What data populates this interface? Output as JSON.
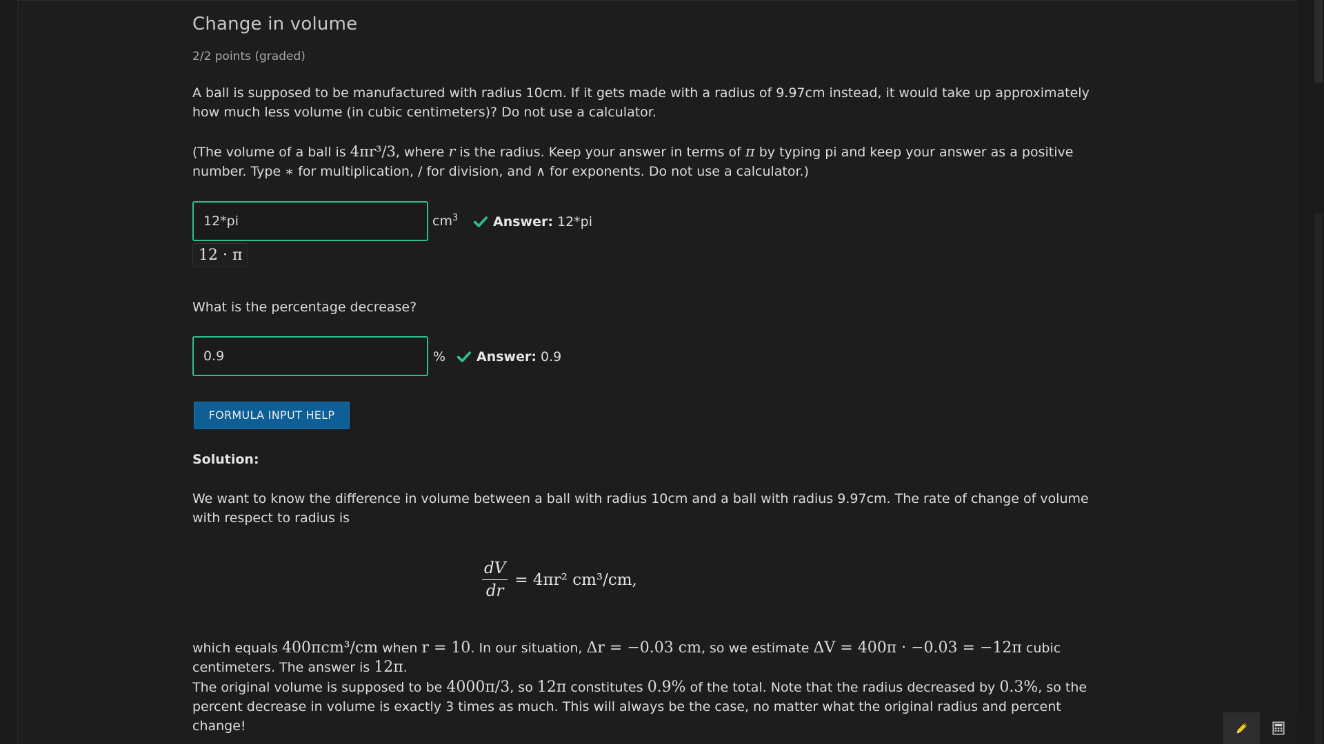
{
  "problem": {
    "title": "Change in volume",
    "points": "2/2 points (graded)",
    "intro": "A ball is supposed to be manufactured with radius 10cm. If it gets made with a radius of 9.97cm instead, it would take up approximately how much less volume (in cubic centimeters)? Do not use a calculator.",
    "note_prefix": "(The volume of a ball is ",
    "note_formula": "4πr³/3",
    "note_mid1": ", where ",
    "note_var": "r",
    "note_mid2": " is the radius. Keep your answer in terms of ",
    "note_pi": "π",
    "note_mid3": " by typing pi and keep your answer as a positive number. Type ",
    "note_star": "∗",
    "note_mid4": " for multiplication, / for division, and ",
    "note_caret": "∧",
    "note_suffix": " for exponents. Do not use a calculator.)"
  },
  "q1": {
    "input_value": "12*pi",
    "unit": "cm",
    "unit_sup": "3",
    "answer_label": "Answer:",
    "answer_value": "12*pi",
    "preview": "12 · π"
  },
  "q2": {
    "prompt": "What is the percentage decrease?",
    "input_value": "0.9",
    "unit": "%",
    "answer_label": "Answer:",
    "answer_value": "0.9"
  },
  "buttons": {
    "formula_help": "FORMULA INPUT HELP"
  },
  "solution": {
    "heading": "Solution:",
    "p1": "We want to know the difference in volume between a ball with radius 10cm and a ball with radius 9.97cm. The rate of change of volume with respect to radius is",
    "eq_num": "dV",
    "eq_den": "dr",
    "eq_rhs": "= 4πr² cm³/cm,",
    "p2a": "which equals ",
    "p2_m1": "400πcm³/cm",
    "p2b": " when ",
    "p2_m2": "r = 10",
    "p2c": ". In our situation, ",
    "p2_m3": "Δr = −0.03 cm",
    "p2d": ", so we estimate ",
    "p2_m4": "ΔV = 400π · −0.03 = −12π",
    "p2e": " cubic centimeters. The answer is ",
    "p2_m5": "12π",
    "p2f": ".",
    "p3a": "The original volume is supposed to be ",
    "p3_m1": "4000π/3",
    "p3b": ", so ",
    "p3_m2": "12π",
    "p3c": " constitutes ",
    "p3_m3": "0.9%",
    "p3d": " of the total. Note that the radius decreased by ",
    "p3_m4": "0.3%",
    "p3e": ", so the percent decrease in volume is exactly 3 times as much. This will always be the case, no matter what the original radius and percent change!"
  },
  "tools": {
    "pen": "pencil-icon",
    "calc": "calculator-icon"
  },
  "colors": {
    "correct": "#2fbf8a",
    "button": "#0e5f96",
    "pen_icon": "#f1c40f"
  }
}
